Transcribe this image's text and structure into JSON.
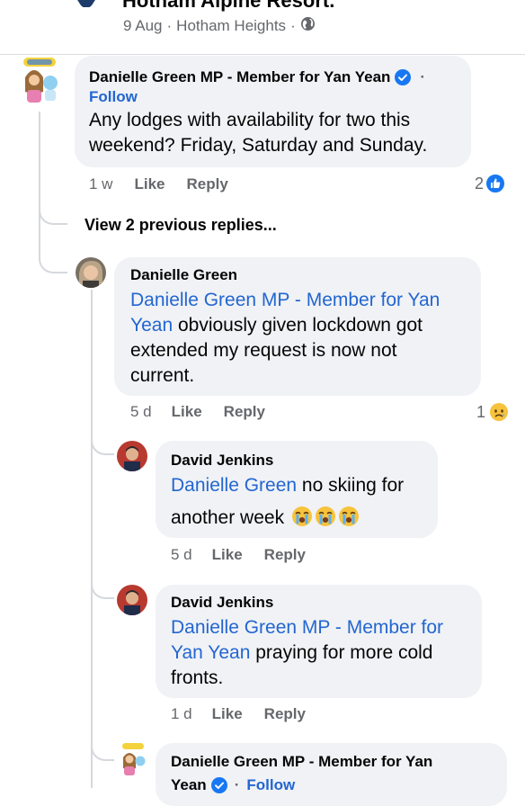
{
  "post": {
    "title": "Hotham Alpine Resort.",
    "date": "9 Aug",
    "location": "Hotham Heights",
    "separator": "·",
    "privacy_icon": "globe-icon"
  },
  "comments": [
    {
      "author": "Danielle Green MP - Member for Yan Yean",
      "verified_icon": "verified-badge-icon",
      "dot": "·",
      "follow_label": "Follow",
      "text": "Any lodges with availability for two this weekend? Friday, Saturday and Sunday.",
      "time": "1 w",
      "like_label": "Like",
      "reply_label": "Reply",
      "reaction_count": "2",
      "reaction_icon": "like-reaction-icon"
    }
  ],
  "view_previous": "View 2 previous replies...",
  "replies": [
    {
      "author": "Danielle Green",
      "mention": "Danielle Green MP - Member for Yan Yean",
      "text": " obviously given lockdown got extended my request is now not current.",
      "time": "5 d",
      "like_label": "Like",
      "reply_label": "Reply",
      "reaction_count": "1",
      "reaction_icon": "sad-reaction-icon"
    },
    {
      "author": "David Jenkins",
      "mention": "Danielle Green",
      "text_line1": " no skiing for",
      "text_line2": "another week",
      "emojis": [
        "crying-face-icon",
        "crying-face-icon",
        "crying-face-icon"
      ],
      "time": "5 d",
      "like_label": "Like",
      "reply_label": "Reply"
    },
    {
      "author": "David Jenkins",
      "mention": "Danielle Green MP - Member for Yan Yean",
      "text": " praying for more cold fronts.",
      "time": "1 d",
      "like_label": "Like",
      "reply_label": "Reply"
    },
    {
      "author": "Danielle Green MP - Member for Yan",
      "author_line2": "Yean",
      "dot": "·",
      "follow_label": "Follow"
    }
  ],
  "colors": {
    "link_blue": "#2366d1",
    "bubble_bg": "#f0f2f5",
    "meta_grey": "#65676b"
  }
}
